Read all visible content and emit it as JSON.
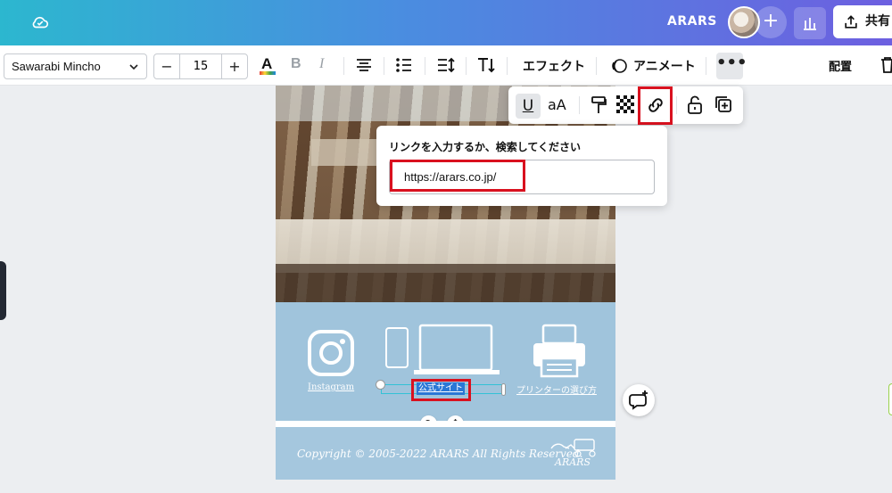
{
  "topbar": {
    "brand": "ARARS",
    "share_label": "共有",
    "plus_label": "+"
  },
  "toolbar": {
    "font_name": "Sawarabi Mincho",
    "font_size": "15",
    "minus_label": "−",
    "plus_label": "+",
    "bold_label": "B",
    "italic_label": "I",
    "effects_label": "エフェクト",
    "animate_label": "アニメート",
    "position_label": "配置",
    "more_label": "•••"
  },
  "float_bar": {
    "underline_label": "U",
    "case_label": "aA"
  },
  "link_popup": {
    "title": "リンクを入力するか、検索してください",
    "url_value": "https://arars.co.jp/"
  },
  "canvas": {
    "instagram_label": "Instagram",
    "official_site_label": "公式サイト",
    "printer_label": "プリンターの選び方",
    "copyright": "Copyright © 2005-2022 ARARS All Rights Reserved.",
    "logo_text": "ARARS"
  },
  "colors": {
    "accent_red": "#d9111f",
    "selection": "#33c2d6",
    "band": "#a0c4dc",
    "topbar_start": "#2cb7cf",
    "topbar_end": "#6d5fe0"
  }
}
